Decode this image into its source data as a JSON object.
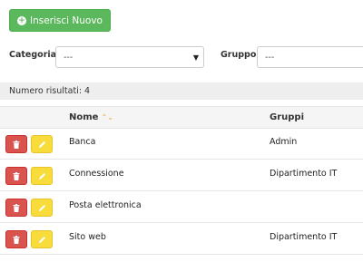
{
  "toolbar": {
    "new_label": "Inserisci Nuovo"
  },
  "filters": {
    "categoria_label": "Categoria",
    "categoria_value": "---",
    "gruppo_label": "Gruppo",
    "gruppo_value": "---"
  },
  "results": {
    "text": "Numero risultati: 4"
  },
  "table": {
    "headers": {
      "nome": "Nome",
      "gruppi": "Gruppi"
    },
    "rows": [
      {
        "nome": "Banca",
        "gruppi": "Admin"
      },
      {
        "nome": "Connessione",
        "gruppi": "Dipartimento IT"
      },
      {
        "nome": "Posta elettronica",
        "gruppi": ""
      },
      {
        "nome": "Sito web",
        "gruppi": "Dipartimento IT"
      }
    ]
  },
  "colors": {
    "success": "#5cb85c",
    "danger": "#d9534f",
    "warning": "#f7dc3b",
    "sort": "#f0ad4e"
  }
}
